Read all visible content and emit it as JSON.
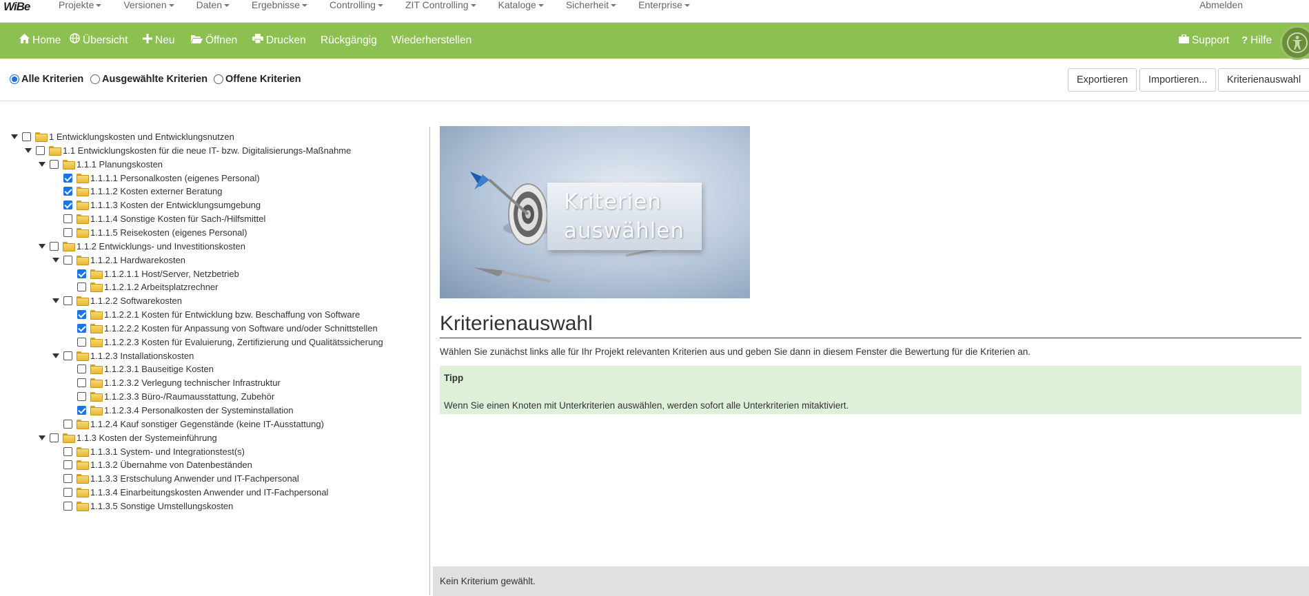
{
  "app": {
    "logo_main": "WiBe",
    "logo_accent": ""
  },
  "menubar": {
    "items": [
      "Projekte",
      "Versionen",
      "Daten",
      "Ergebnisse",
      "Controlling",
      "ZIT Controlling",
      "Kataloge",
      "Sicherheit",
      "Enterprise"
    ],
    "logout": "Abmelden"
  },
  "toolbar": {
    "home": "Home",
    "overview": "Übersicht",
    "new": "Neu",
    "open": "Öffnen",
    "print": "Drucken",
    "undo": "Rückgängig",
    "redo": "Wiederherstellen",
    "support": "Support",
    "help": "Hilfe"
  },
  "filter": {
    "all": "Alle Kriterien",
    "selected": "Ausgewählte Kriterien",
    "open": "Offene Kriterien",
    "active": "all"
  },
  "buttons": {
    "export": "Exportieren",
    "import": "Importieren...",
    "selection": "Kriterienauswahl"
  },
  "tree": [
    {
      "label": "1 Entwicklungskosten und Entwicklungsnutzen",
      "level": 0,
      "expandable": true,
      "checked": false
    },
    {
      "label": "1.1 Entwicklungskosten für die neue IT- bzw. Digitalisierungs-Maßnahme",
      "level": 1,
      "expandable": true,
      "checked": false
    },
    {
      "label": "1.1.1 Planungskosten",
      "level": 2,
      "expandable": true,
      "checked": false
    },
    {
      "label": "1.1.1.1 Personalkosten (eigenes Personal)",
      "level": 3,
      "expandable": false,
      "checked": true
    },
    {
      "label": "1.1.1.2 Kosten externer Beratung",
      "level": 3,
      "expandable": false,
      "checked": true
    },
    {
      "label": "1.1.1.3 Kosten der Entwicklungsumgebung",
      "level": 3,
      "expandable": false,
      "checked": true
    },
    {
      "label": "1.1.1.4 Sonstige Kosten für Sach-/Hilfsmittel",
      "level": 3,
      "expandable": false,
      "checked": false
    },
    {
      "label": "1.1.1.5 Reisekosten (eigenes Personal)",
      "level": 3,
      "expandable": false,
      "checked": false
    },
    {
      "label": "1.1.2 Entwicklungs- und Investitionskosten",
      "level": 2,
      "expandable": true,
      "checked": false
    },
    {
      "label": "1.1.2.1 Hardwarekosten",
      "level": 3,
      "expandable": true,
      "checked": false
    },
    {
      "label": "1.1.2.1.1 Host/Server, Netzbetrieb",
      "level": 4,
      "expandable": false,
      "checked": true
    },
    {
      "label": "1.1.2.1.2 Arbeitsplatzrechner",
      "level": 4,
      "expandable": false,
      "checked": false
    },
    {
      "label": "1.1.2.2 Softwarekosten",
      "level": 3,
      "expandable": true,
      "checked": false
    },
    {
      "label": "1.1.2.2.1 Kosten für Entwicklung bzw. Beschaffung von Software",
      "level": 4,
      "expandable": false,
      "checked": true
    },
    {
      "label": "1.1.2.2.2 Kosten für Anpassung von Software und/oder Schnittstellen",
      "level": 4,
      "expandable": false,
      "checked": true
    },
    {
      "label": "1.1.2.2.3 Kosten für Evaluierung, Zertifizierung und Qualitätssicherung",
      "level": 4,
      "expandable": false,
      "checked": false
    },
    {
      "label": "1.1.2.3 Installationskosten",
      "level": 3,
      "expandable": true,
      "checked": false
    },
    {
      "label": "1.1.2.3.1 Bauseitige Kosten",
      "level": 4,
      "expandable": false,
      "checked": false
    },
    {
      "label": "1.1.2.3.2 Verlegung technischer Infrastruktur",
      "level": 4,
      "expandable": false,
      "checked": false
    },
    {
      "label": "1.1.2.3.3 Büro-/Raumausstattung, Zubehör",
      "level": 4,
      "expandable": false,
      "checked": false
    },
    {
      "label": "1.1.2.3.4 Personalkosten der Systeminstallation",
      "level": 4,
      "expandable": false,
      "checked": true
    },
    {
      "label": "1.1.2.4 Kauf sonstiger Gegenstände (keine IT-Ausstattung)",
      "level": 3,
      "expandable": false,
      "checked": false
    },
    {
      "label": "1.1.3 Kosten der Systemeinführung",
      "level": 2,
      "expandable": true,
      "checked": false
    },
    {
      "label": "1.1.3.1 System- und Integrationstest(s)",
      "level": 3,
      "expandable": false,
      "checked": false
    },
    {
      "label": "1.1.3.2 Übernahme von Datenbeständen",
      "level": 3,
      "expandable": false,
      "checked": false
    },
    {
      "label": "1.1.3.3 Erstschulung Anwender und IT-Fachpersonal",
      "level": 3,
      "expandable": false,
      "checked": false
    },
    {
      "label": "1.1.3.4 Einarbeitungskosten Anwender und IT-Fachpersonal",
      "level": 3,
      "expandable": false,
      "checked": false
    },
    {
      "label": "1.1.3.5 Sonstige Umstellungskosten",
      "level": 3,
      "expandable": false,
      "checked": false
    }
  ],
  "panel": {
    "hero_line1": "Kriterien",
    "hero_line2": "auswählen",
    "title": "Kriterienauswahl",
    "description": "Wählen Sie zunächst links alle für Ihr Projekt relevanten Kriterien aus und geben Sie dann in diesem Fenster die Bewertung für die Kriterien an.",
    "tip_heading": "Tipp",
    "tip_body": "Wenn Sie einen Knoten mit Unterkriterien auswählen, werden sofort alle Unterkriterien mitaktiviert."
  },
  "status": {
    "text": "Kein Kriterium gewählt."
  },
  "colors": {
    "toolbar": "#8cc152",
    "tip_bg": "#dff0d8",
    "checkbox_on": "#1a73e8",
    "status_bg": "#e0e0e0"
  }
}
